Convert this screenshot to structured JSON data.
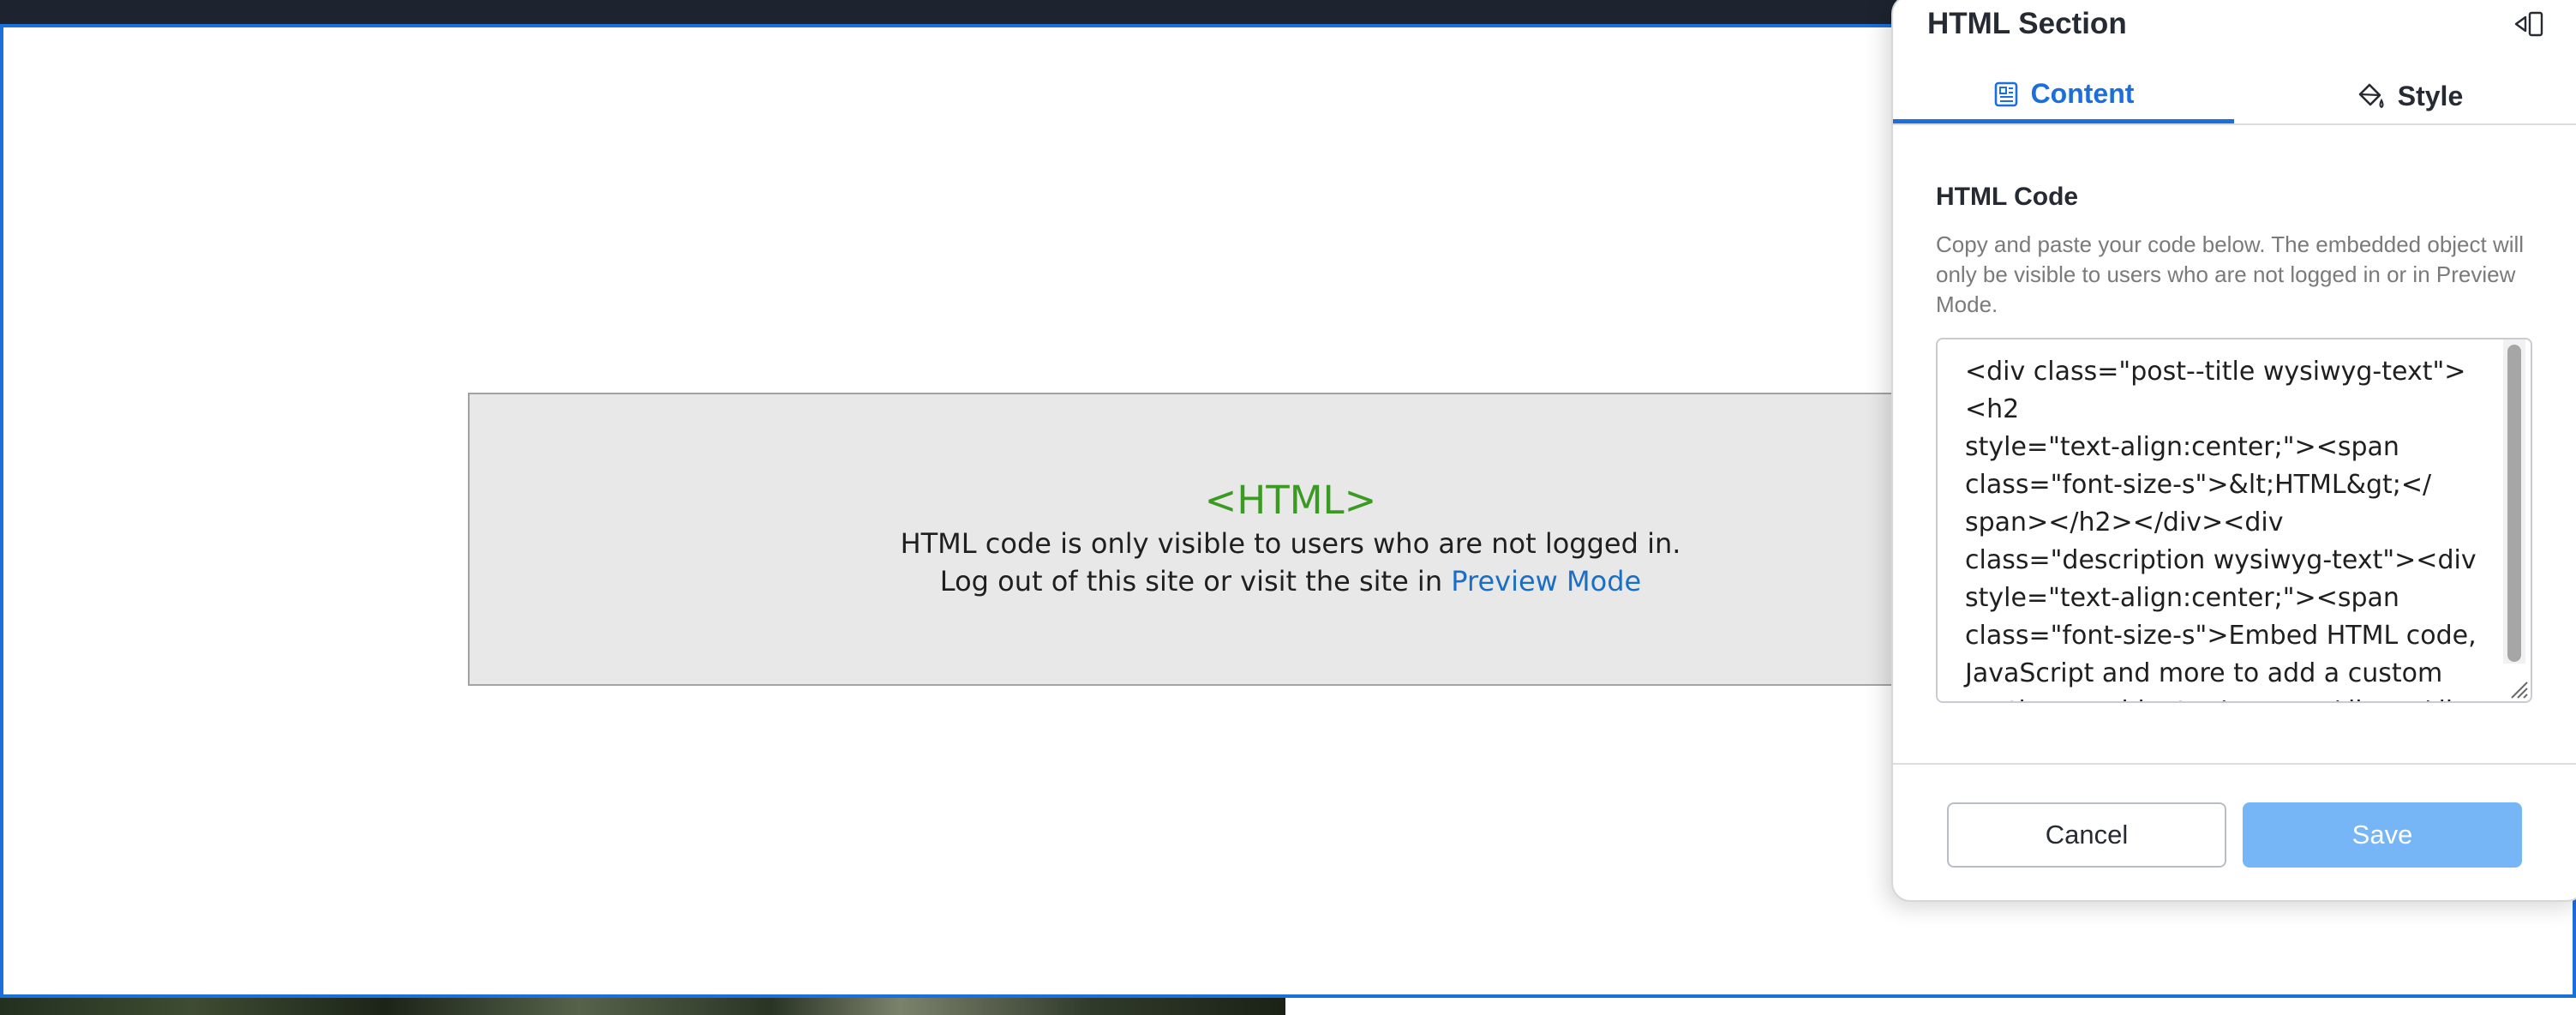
{
  "html_preview": {
    "title": "<HTML>",
    "line1": "HTML code is only visible to users who are not logged in.",
    "line2_prefix": "Log out of this site or visit the site in ",
    "preview_link": "Preview Mode"
  },
  "panel": {
    "title": "HTML Section",
    "collapse_icon": "collapse-panel-icon",
    "tabs": [
      {
        "label": "Content",
        "icon": "content-layout-icon",
        "active": true
      },
      {
        "label": "Style",
        "icon": "paint-bucket-icon",
        "active": false
      }
    ],
    "field": {
      "label": "HTML Code",
      "help": "Copy and paste your code below. The embedded object will only be visible to users who are not logged in or in Preview Mode.",
      "value": "<div class=\"post--title wysiwyg-text\"><h2\nstyle=\"text-align:center;\"><span\nclass=\"font-size-s\">&lt;HTML&gt;</\nspan></h2></div><div\nclass=\"description wysiwyg-text\"><div\nstyle=\"text-align:center;\"><span\nclass=\"font-size-s\">Embed HTML code,\nJavaScript and more to add a custom\nsection or widget.</span></div></div>"
    },
    "buttons": {
      "cancel": "Cancel",
      "save": "Save"
    }
  },
  "colors": {
    "accent": "#1a6fdb",
    "html_tag_green": "#3a9a22",
    "link": "#1a6fc4",
    "save_disabled": "#76b6f6",
    "topbar": "#1d2430"
  }
}
